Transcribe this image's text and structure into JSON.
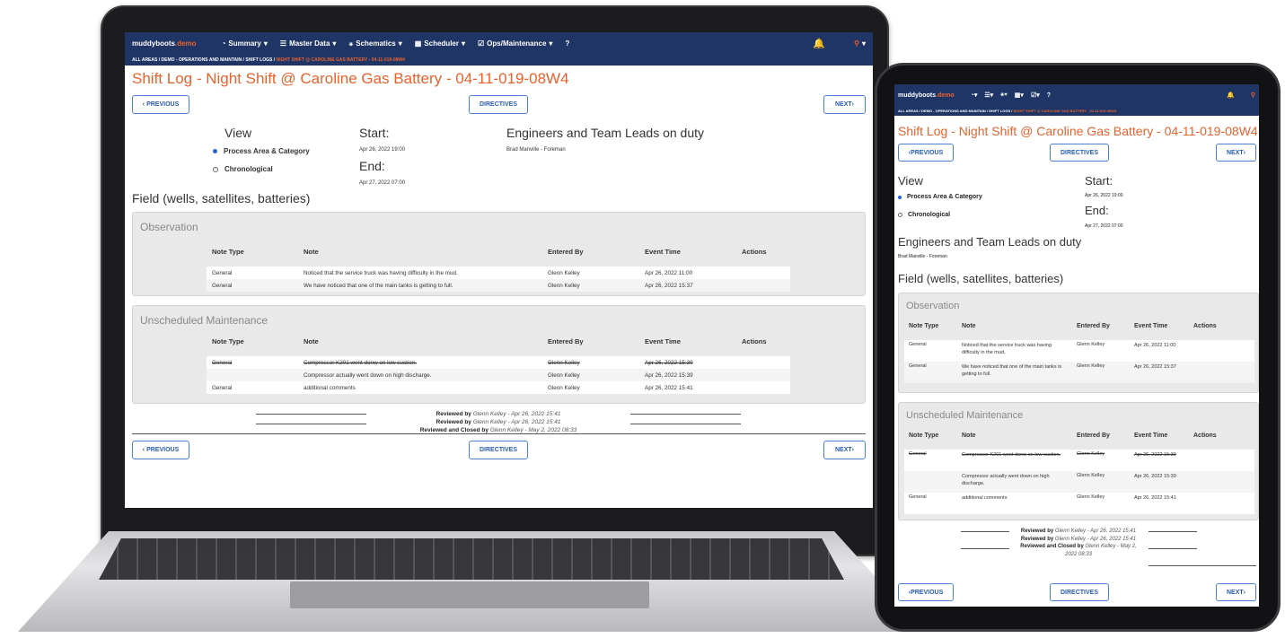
{
  "app": {
    "brand_name": "muddyboots",
    "brand_suffix": ".demo",
    "menu": [
      "Summary",
      "Master Data",
      "Schematics",
      "Scheduler",
      "Ops/Maintenance"
    ],
    "help_symbol": "?",
    "breadcrumb": [
      "ALL AREAS",
      "DEMO - OPERATIONS AND MAINTAIN",
      "SHIFT LOGS",
      "NIGHT SHIFT @ CAROLINE GAS BATTERY - 04-11-019-08W4"
    ],
    "breadcrumb_sep": "/",
    "page_title": "Shift Log - Night Shift @ Caroline Gas Battery - 04-11-019-08W4",
    "prev_label": "PREVIOUS",
    "next_label": "NEXT",
    "directives_label": "DIRECTIVES",
    "view_heading": "View",
    "view_options": [
      "Process Area & Category",
      "Chronological"
    ],
    "start_label": "Start:",
    "start_value": "Apr 26, 2022 19:00",
    "end_label": "End:",
    "end_value": "Apr 27, 2022 07:00",
    "engineers_heading": "Engineers and Team Leads on duty",
    "engineer": "Brad Manville - Foreman",
    "section_heading": "Field (wells, satellites, batteries)",
    "columns": [
      "Note Type",
      "Note",
      "Entered By",
      "Event Time",
      "Actions"
    ],
    "observation": {
      "title": "Observation",
      "rows": [
        {
          "type": "General",
          "note": "Noticed that the service truck was having difficulty in the mud.",
          "by": "Glenn Kelley",
          "time": "Apr 26, 2022 11:00"
        },
        {
          "type": "General",
          "note": "We have noticed that one of the main tanks is getting to full.",
          "by": "Glenn Kelley",
          "time": "Apr 26, 2022 15:37"
        }
      ]
    },
    "maintenance": {
      "title": "Unscheduled Maintenance",
      "rows": [
        {
          "type": "General",
          "note": "Compressor K201 went donw on low suction.",
          "by": "Glenn Kelley",
          "time": "Apr 26, 2022 15:39",
          "struck": true
        },
        {
          "type": "",
          "note": "Compressor actually went down on high discharge.",
          "by": "Glenn Kelley",
          "time": "Apr 26, 2022 15:39"
        },
        {
          "type": "General",
          "note": "additional comments",
          "by": "Glenn Kelley",
          "time": "Apr 26, 2022 15:41"
        }
      ]
    },
    "reviews": [
      {
        "label": "Reviewed by",
        "who": "Glenn Kelley - Apr 26, 2022 15:41"
      },
      {
        "label": "Reviewed by",
        "who": "Glenn Kelley - Apr 26, 2022 15:41"
      },
      {
        "label": "Reviewed and Closed by",
        "who": "Glenn Kelley - May 2, 2022 08:33"
      }
    ]
  },
  "colors": {
    "nav": "#1f3566",
    "accent": "#e8622c",
    "button": "#2a5db0",
    "panel": "#e9e9ea"
  },
  "icons": [
    "dashboard-icon",
    "database-icon",
    "schematics-icon",
    "calendar-icon",
    "checklist-icon",
    "help-icon",
    "bell-icon",
    "user-icon"
  ]
}
